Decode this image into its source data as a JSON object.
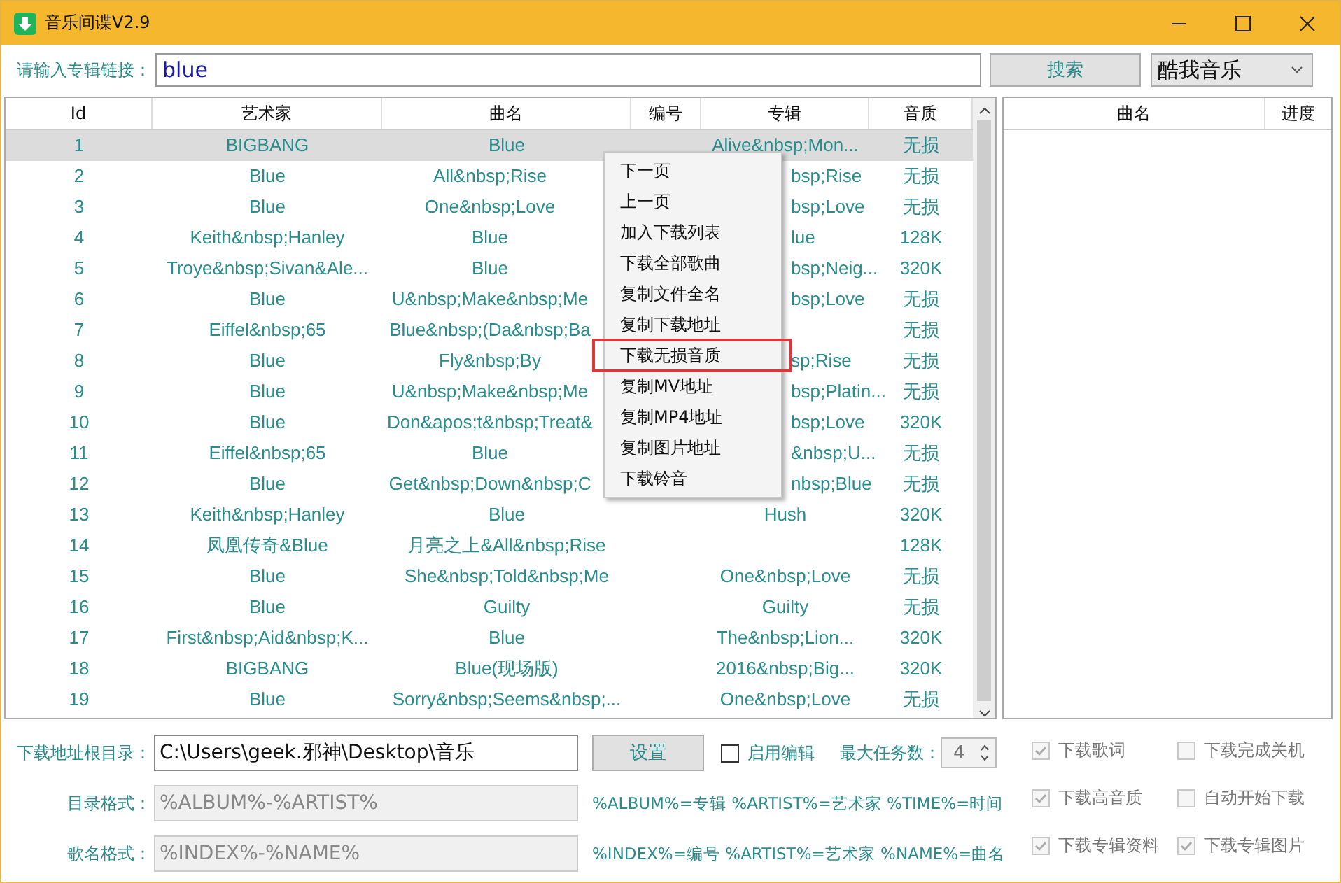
{
  "window": {
    "title": "音乐间谍V2.9"
  },
  "search": {
    "label": "请输入专辑链接：",
    "value": "blue",
    "button": "搜索",
    "source": "酷我音乐"
  },
  "table": {
    "columns": [
      "Id",
      "艺术家",
      "曲名",
      "编号",
      "专辑",
      "音质"
    ],
    "rows": [
      {
        "id": "1",
        "artist": "BIGBANG",
        "song": "Blue",
        "album": "Alive&nbsp;Mon...",
        "quality": "无损",
        "selected": true
      },
      {
        "id": "2",
        "artist": "Blue",
        "song": "All&nbsp;Rise",
        "album": "bsp;Rise",
        "quality": "无损",
        "selected": false
      },
      {
        "id": "3",
        "artist": "Blue",
        "song": "One&nbsp;Love",
        "album": "bsp;Love",
        "quality": "无损",
        "selected": false
      },
      {
        "id": "4",
        "artist": "Keith&nbsp;Hanley",
        "song": "Blue",
        "album": "lue",
        "quality": "128K",
        "selected": false
      },
      {
        "id": "5",
        "artist": "Troye&nbsp;Sivan&Ale...",
        "song": "Blue",
        "album": "bsp;Neig...",
        "quality": "320K",
        "selected": false
      },
      {
        "id": "6",
        "artist": "Blue",
        "song": "U&nbsp;Make&nbsp;Me",
        "album": "bsp;Love",
        "quality": "无损",
        "selected": false
      },
      {
        "id": "7",
        "artist": "Eiffel&nbsp;65",
        "song": "Blue&nbsp;(Da&nbsp;Ba",
        "album": "",
        "quality": "无损",
        "selected": false
      },
      {
        "id": "8",
        "artist": "Blue",
        "song": "Fly&nbsp;By",
        "album": "sp;Rise",
        "quality": "无损",
        "selected": false
      },
      {
        "id": "9",
        "artist": "Blue",
        "song": "U&nbsp;Make&nbsp;Me",
        "album": "bsp;Platin...",
        "quality": "无损",
        "selected": false
      },
      {
        "id": "10",
        "artist": "Blue",
        "song": "Don&apos;t&nbsp;Treat&",
        "album": "bsp;Love",
        "quality": "320K",
        "selected": false
      },
      {
        "id": "11",
        "artist": "Eiffel&nbsp;65",
        "song": "Blue",
        "album": "&nbsp;U...",
        "quality": "无损",
        "selected": false
      },
      {
        "id": "12",
        "artist": "Blue",
        "song": "Get&nbsp;Down&nbsp;C",
        "album": "nbsp;Blue",
        "quality": "无损",
        "selected": false
      },
      {
        "id": "13",
        "artist": "Keith&nbsp;Hanley",
        "song": "Blue",
        "album": "Hush",
        "quality": "320K",
        "selected": false
      },
      {
        "id": "14",
        "artist": "凤凰传奇&Blue",
        "song": "月亮之上&All&nbsp;Rise",
        "album": "",
        "quality": "128K",
        "selected": false
      },
      {
        "id": "15",
        "artist": "Blue",
        "song": "She&nbsp;Told&nbsp;Me",
        "album": "One&nbsp;Love",
        "quality": "无损",
        "selected": false
      },
      {
        "id": "16",
        "artist": "Blue",
        "song": "Guilty",
        "album": "Guilty",
        "quality": "无损",
        "selected": false
      },
      {
        "id": "17",
        "artist": "First&nbsp;Aid&nbsp;K...",
        "song": "Blue",
        "album": "The&nbsp;Lion...",
        "quality": "320K",
        "selected": false
      },
      {
        "id": "18",
        "artist": "BIGBANG",
        "song": "Blue(现场版)",
        "album": "2016&nbsp;Big...",
        "quality": "320K",
        "selected": false
      },
      {
        "id": "19",
        "artist": "Blue",
        "song": "Sorry&nbsp;Seems&nbsp;...",
        "album": "One&nbsp;Love",
        "quality": "无损",
        "selected": false
      }
    ]
  },
  "context_menu": [
    {
      "label": "下一页",
      "highlighted": false
    },
    {
      "label": "上一页",
      "highlighted": false
    },
    {
      "label": "加入下载列表",
      "highlighted": false
    },
    {
      "label": "下载全部歌曲",
      "highlighted": false
    },
    {
      "label": "复制文件全名",
      "highlighted": false
    },
    {
      "label": "复制下载地址",
      "highlighted": false
    },
    {
      "label": "下载无损音质",
      "highlighted": true
    },
    {
      "label": "复制MV地址",
      "highlighted": false
    },
    {
      "label": "复制MP4地址",
      "highlighted": false
    },
    {
      "label": "复制图片地址",
      "highlighted": false
    },
    {
      "label": "下载铃音",
      "highlighted": false
    }
  ],
  "download_table": {
    "columns": [
      "曲名",
      "进度"
    ]
  },
  "settings": {
    "path": {
      "label": "下载地址根目录：",
      "value": "C:\\Users\\geek.邪神\\Desktop\\音乐",
      "button": "设置"
    },
    "enable_edit": {
      "label": "启用编辑",
      "checked": false
    },
    "max_tasks": {
      "label": "最大任务数：",
      "value": "4"
    },
    "dir_format": {
      "label": "目录格式：",
      "value": "%ALBUM%-%ARTIST%",
      "disabled": true,
      "hint": "%ALBUM%=专辑 %ARTIST%=艺术家 %TIME%=时间"
    },
    "name_format": {
      "label": "歌名格式：",
      "value": "%INDEX%-%NAME%",
      "disabled": true,
      "hint": "%INDEX%=编号 %ARTIST%=艺术家 %NAME%=曲名"
    },
    "options": [
      {
        "label": "下载歌词",
        "checked": true,
        "disabled": true
      },
      {
        "label": "下载完成关机",
        "checked": false,
        "disabled": true
      },
      {
        "label": "下载高音质",
        "checked": true,
        "disabled": true
      },
      {
        "label": "自动开始下载",
        "checked": false,
        "disabled": true
      },
      {
        "label": "下载专辑资料",
        "checked": true,
        "disabled": true
      },
      {
        "label": "下载专辑图片",
        "checked": true,
        "disabled": true
      }
    ]
  }
}
